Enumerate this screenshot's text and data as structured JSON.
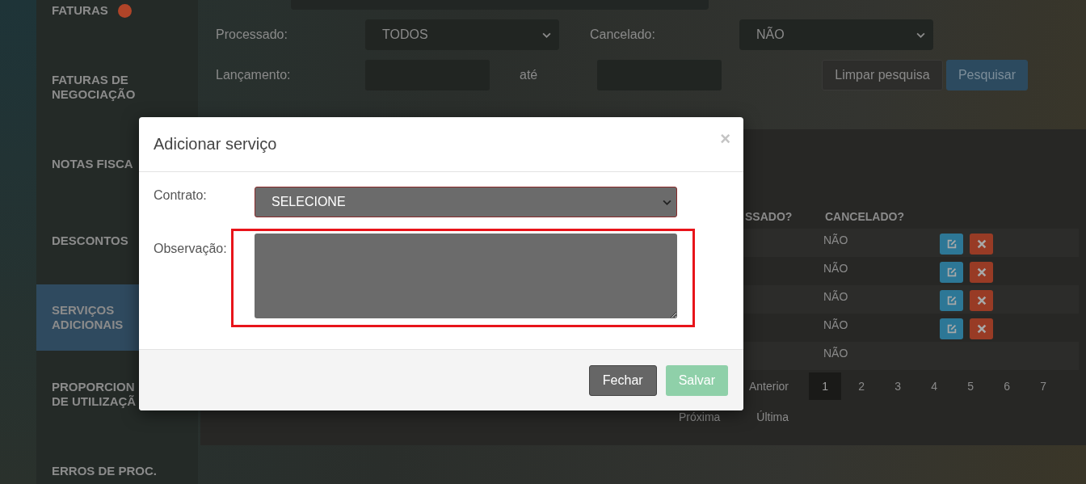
{
  "sidebar": {
    "items": [
      {
        "label": "FATURAS",
        "selected": false,
        "badge": true
      },
      {
        "label": "FATURAS DE NEGOCIAÇÃO",
        "selected": false,
        "badge": false
      },
      {
        "label": "NOTAS FISCA",
        "selected": false,
        "badge": false
      },
      {
        "label": "DESCONTOS",
        "selected": false,
        "badge": false
      },
      {
        "label": "SERVIÇOS ADICIONAIS",
        "selected": true,
        "badge": false
      },
      {
        "label": "PROPORCION\nDE UTILIZAÇÃ",
        "selected": false,
        "badge": false
      },
      {
        "label": "ERROS DE PROC.",
        "selected": false,
        "badge": false
      }
    ]
  },
  "filters": {
    "processado": {
      "label": "Processado:",
      "value": "TODOS"
    },
    "cancelado": {
      "label": "Cancelado:",
      "value": "NÃO"
    },
    "lancamento": {
      "label": "Lançamento:",
      "separator": "até"
    },
    "buttons": [
      {
        "label": "Limpar pesquisa",
        "kind": "secondary"
      },
      {
        "label": "Pesquisar",
        "kind": "primary"
      }
    ]
  },
  "table": {
    "columns": [
      "SSADO?",
      "CANCELADO?"
    ],
    "rows": [
      {
        "cancelado": "NÃO",
        "actions": true
      },
      {
        "cancelado": "NÃO",
        "actions": true
      },
      {
        "cancelado": "NÃO",
        "actions": true
      },
      {
        "cancelado": "NÃO",
        "actions": true
      },
      {
        "cancelado": "NÃO",
        "actions": false
      }
    ]
  },
  "pagination": {
    "previous": "Anterior",
    "pages": [
      {
        "label": "1",
        "selected": true
      },
      {
        "label": "2",
        "selected": false
      },
      {
        "label": "3",
        "selected": false
      },
      {
        "label": "4",
        "selected": false
      },
      {
        "label": "5",
        "selected": false
      },
      {
        "label": "6",
        "selected": false
      },
      {
        "label": "7",
        "selected": false
      }
    ],
    "next": "Próxima",
    "last": "Última"
  },
  "modal": {
    "title": "Adicionar serviço",
    "close": "×",
    "contract": {
      "label": "Contrato:",
      "value": "SELECIONE"
    },
    "observation": {
      "label": "Observação:",
      "highlighted": true
    },
    "buttons": [
      {
        "label": "Fechar",
        "kind": "close",
        "disabled": false
      },
      {
        "label": "Salvar",
        "kind": "save",
        "disabled": true
      }
    ]
  }
}
